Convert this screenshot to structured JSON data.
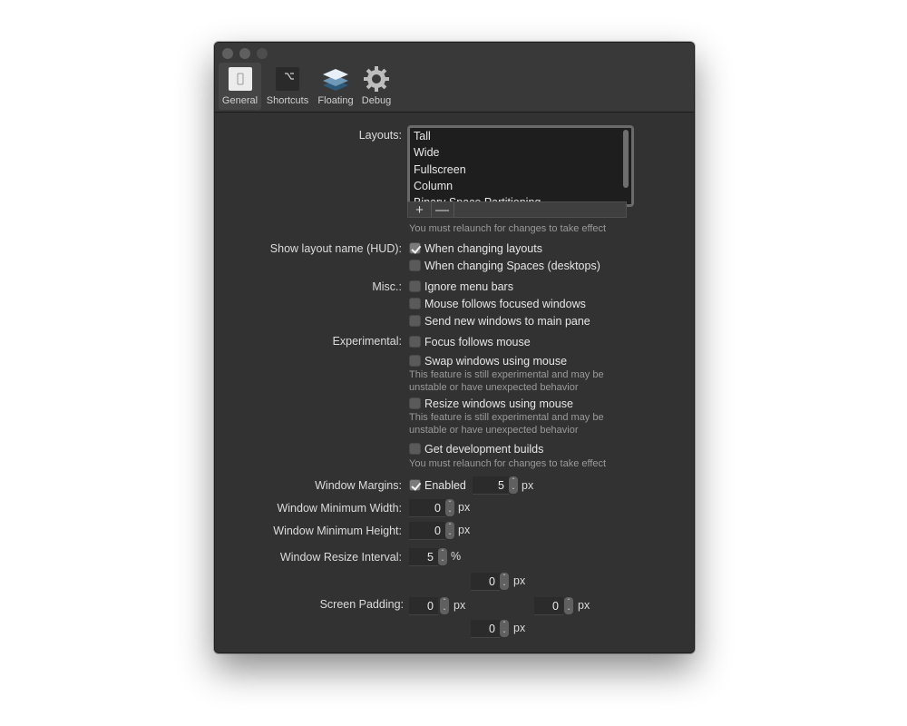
{
  "toolbar": {
    "items": [
      {
        "label": "General",
        "icon": "general-switch-icon",
        "selected": true
      },
      {
        "label": "Shortcuts",
        "icon": "option-key-icon",
        "selected": false
      },
      {
        "label": "Floating",
        "icon": "layers-icon",
        "selected": false
      },
      {
        "label": "Debug",
        "icon": "gear-icon",
        "selected": false
      }
    ]
  },
  "layouts": {
    "label": "Layouts:",
    "items": [
      "Tall",
      "Wide",
      "Fullscreen",
      "Column",
      "Binary Space Partitioning"
    ],
    "add_label": "+",
    "remove_label": "—",
    "note": "You must relaunch for changes to take effect"
  },
  "hud": {
    "label": "Show layout name (HUD):",
    "options": [
      {
        "label": "When changing layouts",
        "checked": true
      },
      {
        "label": "When changing Spaces (desktops)",
        "checked": false
      }
    ]
  },
  "misc": {
    "label": "Misc.:",
    "options": [
      {
        "label": "Ignore menu bars",
        "checked": false
      },
      {
        "label": "Mouse follows focused windows",
        "checked": false
      },
      {
        "label": "Send new windows to main pane",
        "checked": false
      }
    ]
  },
  "experimental": {
    "label": "Experimental:",
    "options": [
      {
        "label": "Focus follows mouse",
        "checked": false
      },
      {
        "label": "Swap windows using mouse",
        "checked": false,
        "note1": "This feature is still experimental and may be",
        "note2": "unstable or have unexpected behavior"
      },
      {
        "label": "Resize windows using mouse",
        "checked": false,
        "note1": "This feature is still experimental and may be",
        "note2": "unstable or have unexpected behavior"
      },
      {
        "label": "Get development builds",
        "checked": false,
        "note1": "You must relaunch for changes to take effect"
      }
    ]
  },
  "window_margins": {
    "label": "Window Margins:",
    "enabled_label": "Enabled",
    "enabled": true,
    "value": "5",
    "unit": "px"
  },
  "min_width": {
    "label": "Window Minimum Width:",
    "value": "0",
    "unit": "px"
  },
  "min_height": {
    "label": "Window Minimum Height:",
    "value": "0",
    "unit": "px"
  },
  "resize_interval": {
    "label": "Window Resize Interval:",
    "value": "5",
    "unit": "%"
  },
  "screen_padding": {
    "label": "Screen Padding:",
    "top": {
      "value": "0",
      "unit": "px"
    },
    "left": {
      "value": "0",
      "unit": "px"
    },
    "right": {
      "value": "0",
      "unit": "px"
    },
    "bottom": {
      "value": "0",
      "unit": "px"
    }
  },
  "stepper": {
    "up": "⌃",
    "down": "⌄"
  }
}
